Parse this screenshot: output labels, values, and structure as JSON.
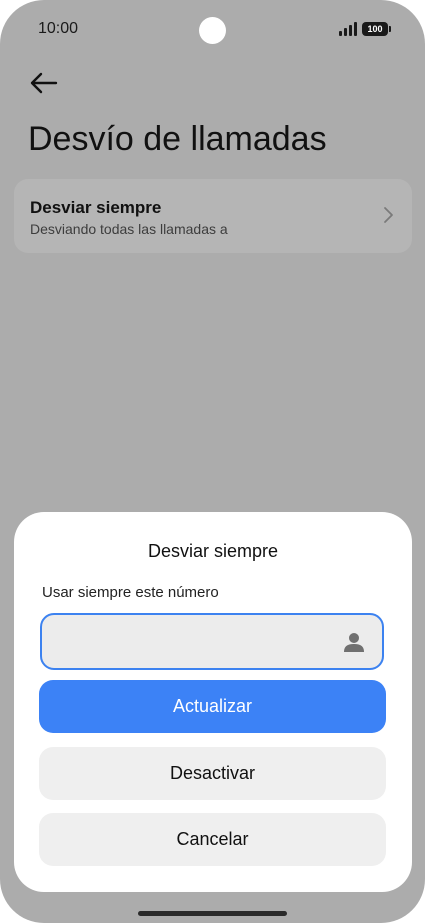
{
  "status_bar": {
    "time": "10:00",
    "battery": "100"
  },
  "header": {
    "back_icon": "arrow-left-icon",
    "title": "Desvío de llamadas"
  },
  "setting": {
    "title": "Desviar siempre",
    "subtitle": "Desviando todas las llamadas a",
    "chevron_icon": "chevron-right-icon"
  },
  "dialog": {
    "title": "Desviar siempre",
    "label": "Usar siempre este número",
    "input_value": "",
    "contact_icon": "person-icon",
    "update_label": "Actualizar",
    "deactivate_label": "Desactivar",
    "cancel_label": "Cancelar"
  },
  "colors": {
    "accent": "#3c82f6",
    "scrim": "#acacac",
    "surface": "#ffffff"
  }
}
